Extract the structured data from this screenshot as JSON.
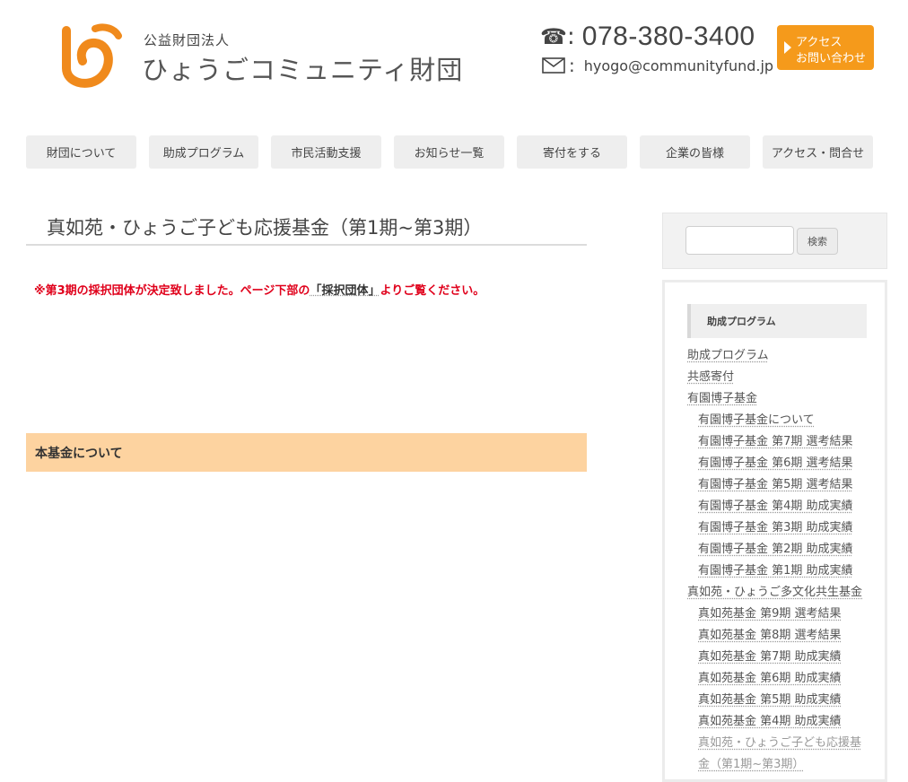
{
  "header": {
    "org_type": "公益財団法人",
    "org_name": "ひょうごコミュニティ財団",
    "phone": "078-380-3400",
    "email": "hyogo@communityfund.jp",
    "colon": ":",
    "access_button": {
      "line1": "アクセス",
      "line2": "お問い合わせ"
    },
    "brand_color": "#f59a1b"
  },
  "nav": [
    {
      "label": "財団について"
    },
    {
      "label": "助成プログラム"
    },
    {
      "label": "市民活動支援"
    },
    {
      "label": "お知らせ一覧"
    },
    {
      "label": "寄付をする"
    },
    {
      "label": "企業の皆様"
    },
    {
      "label": "アクセス・問合せ"
    }
  ],
  "main": {
    "title": "真如苑・ひょうご子ども応援基金（第1期~第3期）",
    "notice_before": "※第3期の採択団体が決定致しました。ページ下部の",
    "notice_link": "「採択団体」",
    "notice_after": "よりご覧ください。",
    "intro": [],
    "section_heading": "本基金について",
    "body": []
  },
  "sidebar": {
    "search_button": "検索",
    "widget_title": "助成プログラム",
    "items": [
      {
        "label": "助成プログラム",
        "level": 0
      },
      {
        "label": "共感寄付",
        "level": 0
      },
      {
        "label": "有園博子基金",
        "level": 0
      },
      {
        "label": "有園博子基金について",
        "level": 1
      },
      {
        "label": "有園博子基金 第7期 選考結果",
        "level": 1
      },
      {
        "label": "有園博子基金 第6期 選考結果",
        "level": 1
      },
      {
        "label": "有園博子基金 第5期 選考結果",
        "level": 1
      },
      {
        "label": "有園博子基金 第4期 助成実績",
        "level": 1
      },
      {
        "label": "有園博子基金 第3期 助成実績",
        "level": 1
      },
      {
        "label": "有園博子基金 第2期 助成実績",
        "level": 1
      },
      {
        "label": "有園博子基金 第1期 助成実績",
        "level": 1
      },
      {
        "label": "真如苑・ひょうご多文化共生基金",
        "level": 0
      },
      {
        "label": "真如苑基金 第9期 選考結果",
        "level": 1
      },
      {
        "label": "真如苑基金 第8期 選考結果",
        "level": 1
      },
      {
        "label": "真如苑基金 第7期 助成実績",
        "level": 1
      },
      {
        "label": "真如苑基金 第6期 助成実績",
        "level": 1
      },
      {
        "label": "真如苑基金 第5期 助成実績",
        "level": 1
      },
      {
        "label": "真如苑基金 第4期 助成実績",
        "level": 1
      },
      {
        "label": "真如苑・ひょうご子ども応援基",
        "level": 1
      },
      {
        "label": "金（第1期~第3期）",
        "level": 1
      }
    ]
  }
}
